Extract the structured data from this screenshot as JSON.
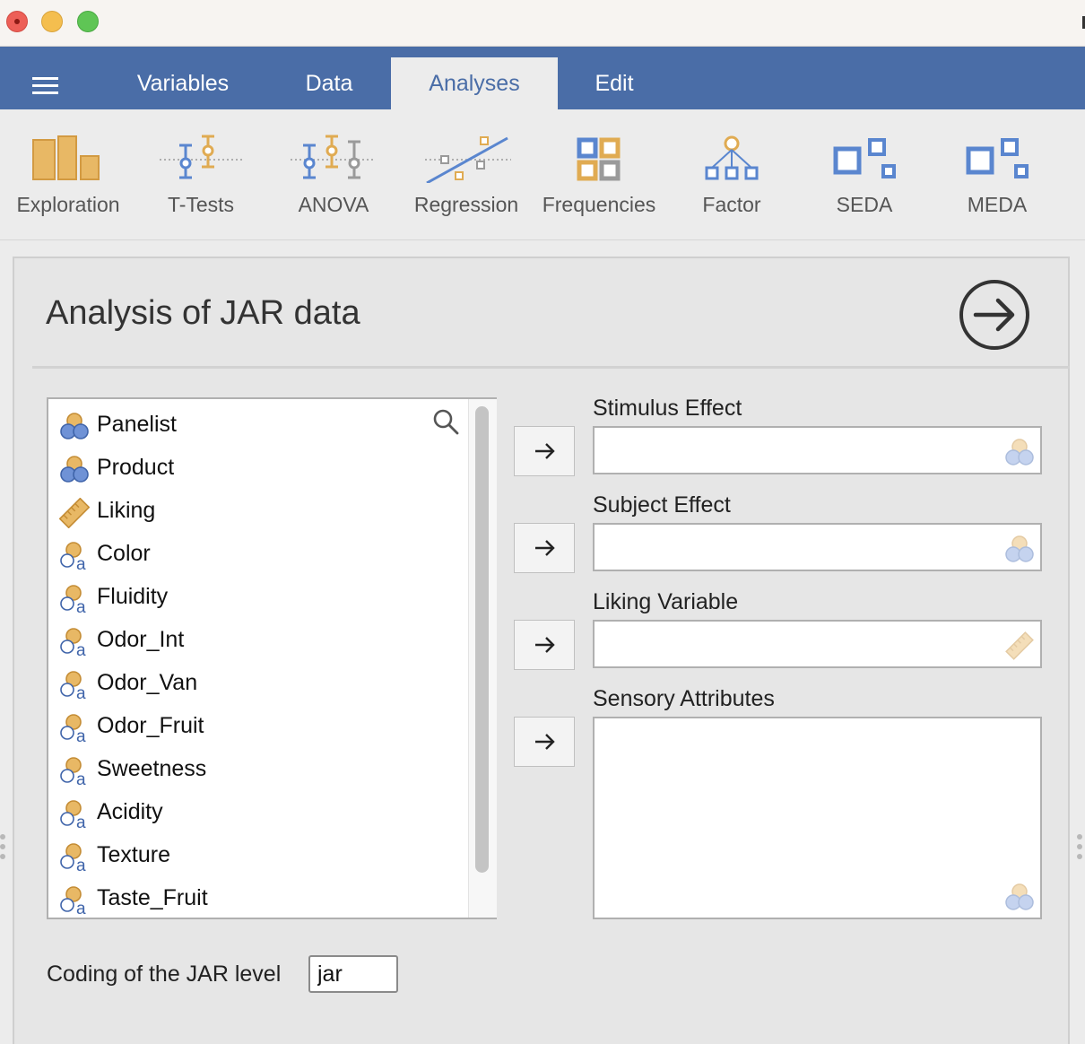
{
  "menubar": {
    "tabs": [
      {
        "label": "Variables"
      },
      {
        "label": "Data"
      },
      {
        "label": "Analyses"
      },
      {
        "label": "Edit"
      }
    ]
  },
  "ribbon": {
    "buttons": [
      {
        "label": "Exploration",
        "icon": "exploration-icon"
      },
      {
        "label": "T-Tests",
        "icon": "t-tests-icon"
      },
      {
        "label": "ANOVA",
        "icon": "anova-icon"
      },
      {
        "label": "Regression",
        "icon": "regression-icon"
      },
      {
        "label": "Frequencies",
        "icon": "frequencies-icon"
      },
      {
        "label": "Factor",
        "icon": "factor-icon"
      },
      {
        "label": "SEDA",
        "icon": "seda-icon"
      },
      {
        "label": "MEDA",
        "icon": "meda-icon"
      }
    ]
  },
  "panel": {
    "title": "Analysis of JAR data",
    "variables": [
      {
        "label": "Panelist",
        "type": "nominal"
      },
      {
        "label": "Product",
        "type": "nominal"
      },
      {
        "label": "Liking",
        "type": "continuous"
      },
      {
        "label": "Color",
        "type": "nominal-text"
      },
      {
        "label": "Fluidity",
        "type": "nominal-text"
      },
      {
        "label": "Odor_Int",
        "type": "nominal-text"
      },
      {
        "label": "Odor_Van",
        "type": "nominal-text"
      },
      {
        "label": "Odor_Fruit",
        "type": "nominal-text"
      },
      {
        "label": "Sweetness",
        "type": "nominal-text"
      },
      {
        "label": "Acidity",
        "type": "nominal-text"
      },
      {
        "label": "Texture",
        "type": "nominal-text"
      },
      {
        "label": "Taste_Fruit",
        "type": "nominal-text"
      }
    ],
    "targets": {
      "stimulus": {
        "label": "Stimulus Effect"
      },
      "subject": {
        "label": "Subject Effect"
      },
      "liking": {
        "label": "Liking Variable"
      },
      "sensory": {
        "label": "Sensory Attributes"
      }
    },
    "coding": {
      "label": "Coding of the JAR level",
      "value": "jar"
    }
  },
  "colors": {
    "menubar": "#4a6da7",
    "accent_orange": "#e0ab52",
    "accent_blue": "#5a86cf"
  }
}
